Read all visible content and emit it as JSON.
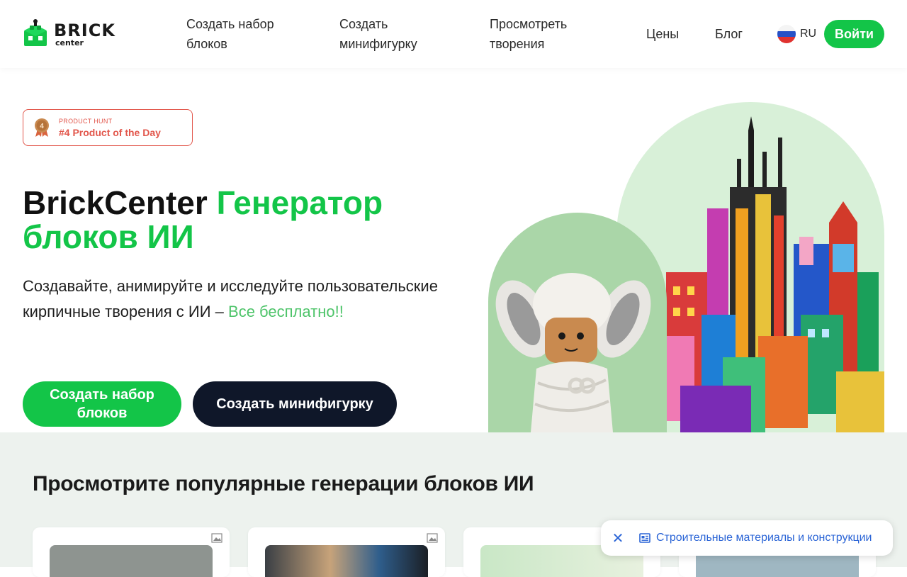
{
  "header": {
    "logo": {
      "word1": "BRICK",
      "word2": "center"
    },
    "nav": [
      {
        "label": "Создать набор блоков"
      },
      {
        "label": "Создать минифигурку"
      },
      {
        "label": "Просмотреть творения"
      },
      {
        "label": "Цены"
      },
      {
        "label": "Блог"
      }
    ],
    "language": "RU",
    "login_label": "Войти"
  },
  "hero": {
    "badge": {
      "small": "PRODUCT HUNT",
      "big": "#4 Product of the Day",
      "rank": "4"
    },
    "title_plain": "BrickCenter ",
    "title_green": "Генератор блоков ИИ",
    "subtitle": "Создавайте, анимируйте и исследуйте пользовательские кирпичные творения с ИИ – ",
    "subtitle_highlight": "Все бесплатно!!",
    "primary_button": "Создать набор блоков",
    "secondary_button": "Создать минифигурку"
  },
  "gallery": {
    "title": "Просмотрите популярные генерации блоков ИИ"
  },
  "toast": {
    "label": "Строительные материалы и конструкции"
  },
  "colors": {
    "accent": "#13c548",
    "dark_button": "#0f1729",
    "badge": "#e2574c",
    "section_bg": "#edf2ee",
    "link": "#2a64d6"
  }
}
